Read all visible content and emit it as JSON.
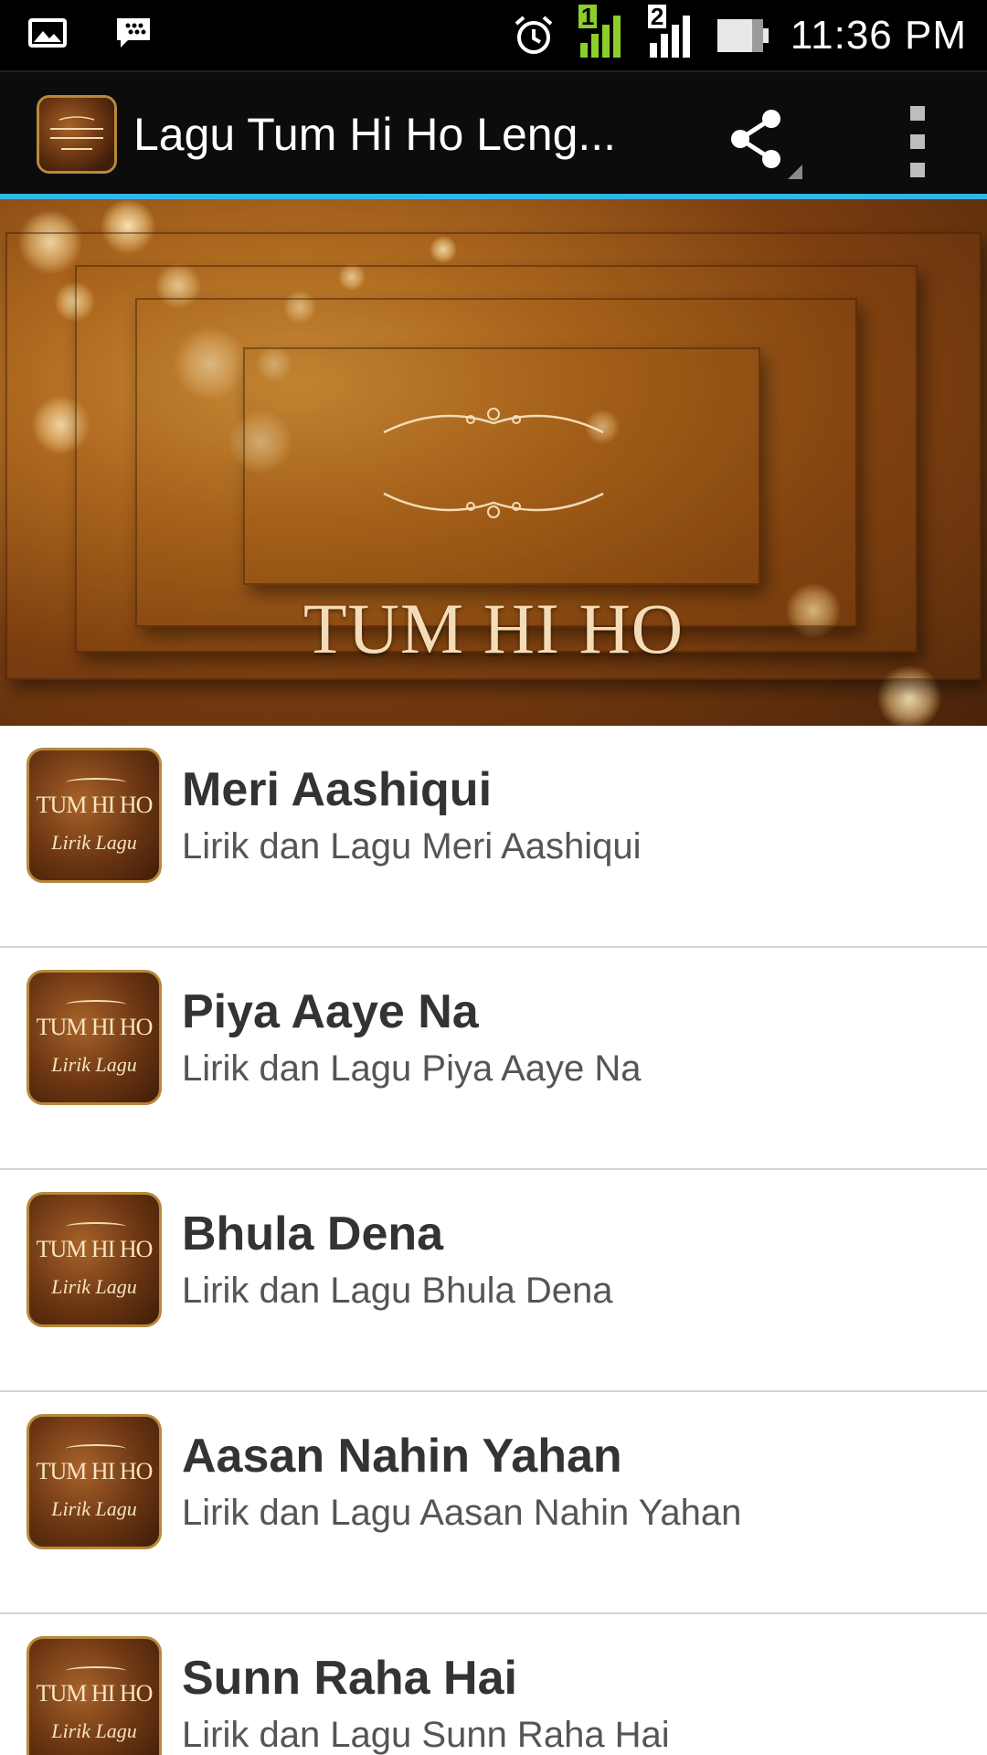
{
  "status_bar": {
    "time": "11:36 PM",
    "icons": [
      "gallery-icon",
      "bbm-icon",
      "alarm-icon",
      "signal-sim1-icon",
      "signal-sim2-icon",
      "battery-icon"
    ],
    "sim1_label": "1",
    "sim2_label": "2",
    "colors": {
      "sim1_signal": "#8ccf2a",
      "sim2_signal": "#ffffff"
    }
  },
  "action_bar": {
    "title": "Lagu Tum Hi Ho Leng...",
    "icons": {
      "app": "app-logo-icon",
      "share": "share-icon",
      "overflow": "overflow-menu-icon"
    },
    "accent_color": "#33b5e5"
  },
  "banner": {
    "title": "TUM HI HO"
  },
  "thumbnail": {
    "title": "TUM HI HO",
    "subtitle": "Lirik Lagu"
  },
  "songs": [
    {
      "title": "Meri Aashiqui",
      "subtitle": "Lirik dan Lagu Meri Aashiqui"
    },
    {
      "title": "Piya Aaye Na",
      "subtitle": "Lirik dan Lagu Piya Aaye Na"
    },
    {
      "title": "Bhula Dena",
      "subtitle": "Lirik dan Lagu Bhula Dena"
    },
    {
      "title": "Aasan Nahin Yahan",
      "subtitle": "Lirik dan Lagu Aasan Nahin Yahan"
    },
    {
      "title": "Sunn Raha Hai",
      "subtitle": "Lirik dan Lagu Sunn Raha Hai"
    }
  ]
}
